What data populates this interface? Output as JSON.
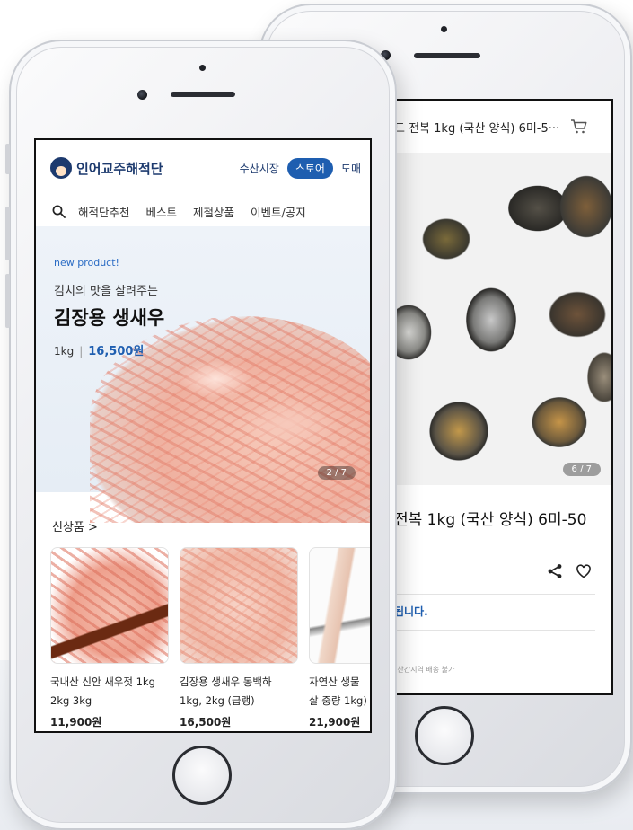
{
  "back_screen": {
    "top_title": "드 전복 1kg (국산 양식) 6미-5···",
    "image_counter": "6 / 7",
    "product_title": "전복 1kg (국산 양식) 6미-50",
    "notice": "됩니다.",
    "fine_print": "서산간지역 배송 불가"
  },
  "front_screen": {
    "logo_text": "인어교주해적단",
    "header_nav": [
      "수산시장",
      "스토어",
      "도매"
    ],
    "active_header_tab": "스토어",
    "nav": [
      "해적단추천",
      "베스트",
      "제철상품",
      "이벤트/공지"
    ],
    "banner": {
      "tag": "new product!",
      "subtitle": "김치의 맛을 살려주는",
      "headline": "김장용 생새우",
      "weight": "1kg",
      "separator": "|",
      "price": "16,500원",
      "counter": "2 / 7"
    },
    "section_title": "신상품 >",
    "products": [
      {
        "name_line1": "국내산 신안 새우젓 1kg",
        "name_line2": "2kg 3kg",
        "price": "11,900원"
      },
      {
        "name_line1": "김장용 생새우 동백하",
        "name_line2": "1kg, 2kg (급랭)",
        "price": "16,500원"
      },
      {
        "name_line1": "자연산 생물",
        "name_line2": "살 중량 1kg)",
        "price": "21,900원"
      }
    ]
  },
  "icons": [
    "cart-icon",
    "share-icon",
    "heart-icon",
    "search-icon",
    "chevron-right-icon",
    "logo-icon"
  ],
  "colors": {
    "brand_navy": "#1d3a6e",
    "accent_blue": "#1e5eb0"
  }
}
